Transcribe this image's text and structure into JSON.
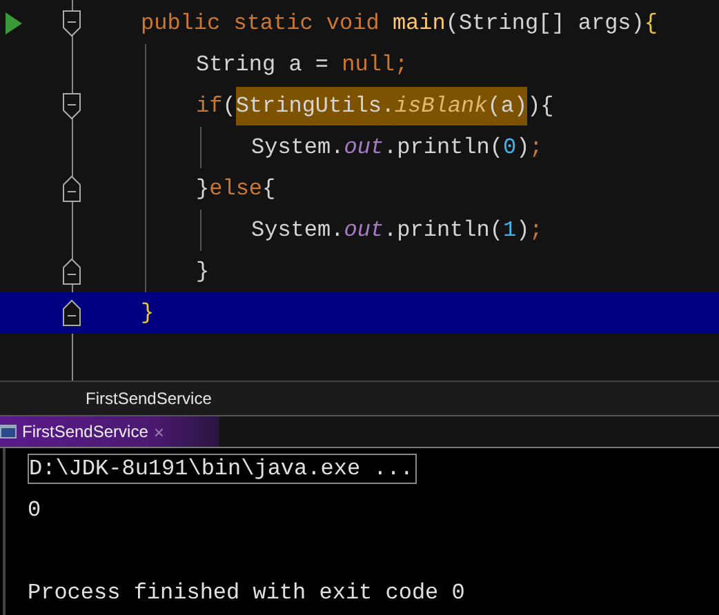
{
  "editor": {
    "lines": [
      {
        "selected": false,
        "run": true,
        "kind": "fold-start",
        "tokens": [
          {
            "kind": "keyword",
            "text": "public static void "
          },
          {
            "kind": "method",
            "text": "main"
          },
          {
            "kind": "plain",
            "text": "(String[] args)"
          },
          {
            "kind": "brace",
            "text": "{"
          }
        ],
        "children": [
          {
            "selected": false,
            "run": false,
            "tokens": [
              {
                "kind": "plain",
                "text": "String a = "
              },
              {
                "kind": "keyword",
                "text": "null;"
              }
            ]
          },
          {
            "selected": false,
            "run": false,
            "kind": "fold-start",
            "tokens": [
              {
                "kind": "keyword",
                "text": "if"
              },
              {
                "kind": "plain",
                "text": "("
              },
              {
                "kind": "highlight",
                "tokens": [
                  {
                    "kind": "plain",
                    "text": "StringUtils."
                  },
                  {
                    "kind": "static-method",
                    "text": "isBlank"
                  },
                  {
                    "kind": "plain",
                    "text": "(a)"
                  }
                ]
              },
              {
                "kind": "plain",
                "text": ")"
              },
              {
                "kind": "plain",
                "text": "{"
              }
            ],
            "children": [
              {
                "selected": false,
                "run": false,
                "tokens": [
                  {
                    "kind": "plain",
                    "text": "System."
                  },
                  {
                    "kind": "static-field",
                    "text": "out"
                  },
                  {
                    "kind": "plain",
                    "text": ".println("
                  },
                  {
                    "kind": "number",
                    "text": "0"
                  },
                  {
                    "kind": "plain",
                    "text": ")"
                  },
                  {
                    "kind": "keyword",
                    "text": ";"
                  }
                ]
              }
            ]
          },
          {
            "selected": false,
            "run": false,
            "kind": "fold-end",
            "tokens": [
              {
                "kind": "plain",
                "text": "}"
              },
              {
                "kind": "keyword",
                "text": "else"
              },
              {
                "kind": "plain",
                "text": "{"
              }
            ],
            "children": [
              {
                "selected": false,
                "run": false,
                "tokens": [
                  {
                    "kind": "plain",
                    "text": "System."
                  },
                  {
                    "kind": "static-field",
                    "text": "out"
                  },
                  {
                    "kind": "plain",
                    "text": ".println("
                  },
                  {
                    "kind": "number",
                    "text": "1"
                  },
                  {
                    "kind": "plain",
                    "text": ")"
                  },
                  {
                    "kind": "keyword",
                    "text": ";"
                  }
                ]
              }
            ]
          },
          {
            "selected": false,
            "run": false,
            "kind": "fold-end",
            "tokens": [
              {
                "kind": "plain",
                "text": "}"
              }
            ]
          }
        ]
      },
      {
        "selected": true,
        "run": false,
        "kind": "fold-end",
        "tokens": [
          {
            "kind": "brace",
            "text": "}"
          }
        ]
      }
    ]
  },
  "breadcrumb": "FirstSendService",
  "run_tab": {
    "label": "FirstSendService",
    "close": "×"
  },
  "console": [
    {
      "kind": "command",
      "text": "D:\\JDK-8u191\\bin\\java.exe ..."
    },
    {
      "kind": "output",
      "text": "0"
    },
    {
      "kind": "blank"
    },
    {
      "kind": "output",
      "text": "Process finished with exit code 0"
    }
  ]
}
